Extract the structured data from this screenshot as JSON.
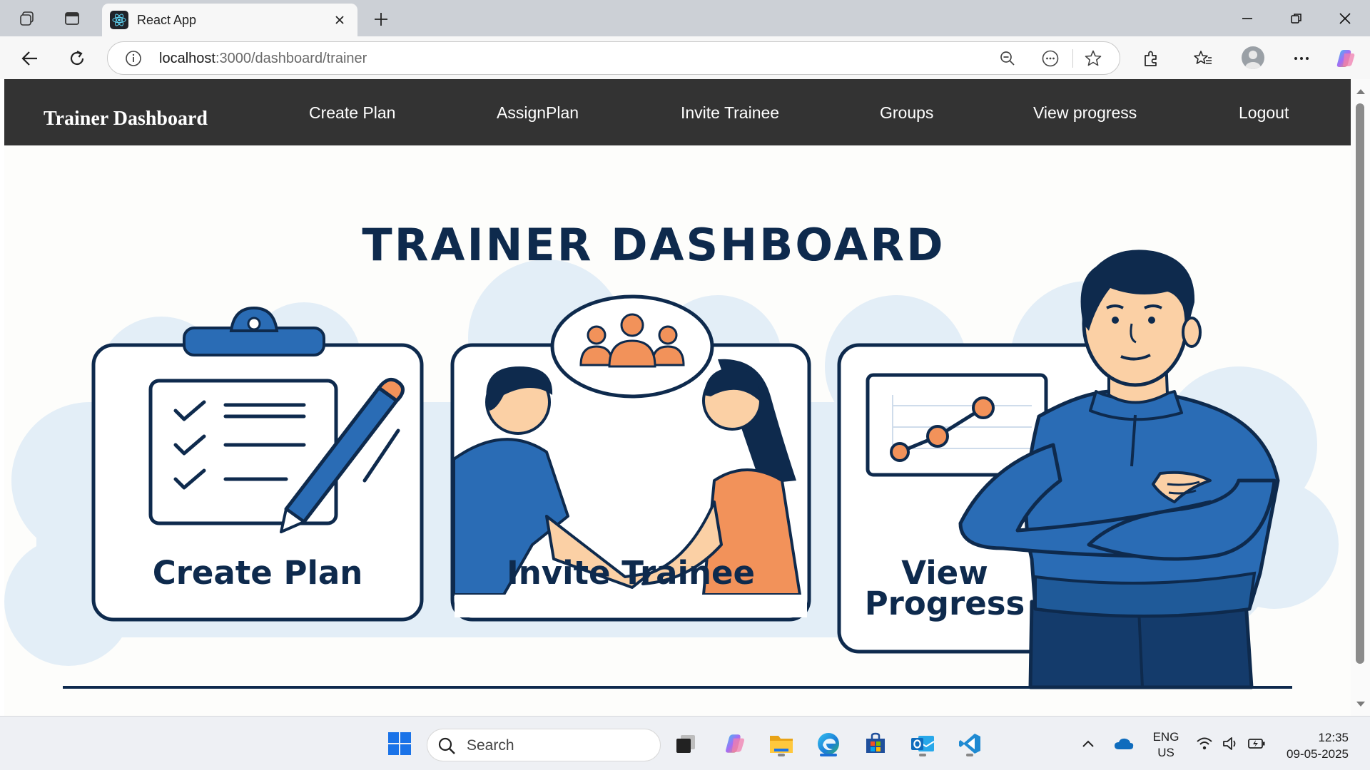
{
  "browser": {
    "tab_title": "React App",
    "url_host": "localhost",
    "url_path": ":3000/dashboard/trainer"
  },
  "app": {
    "brand": "Trainer Dashboard",
    "nav": [
      "Create Plan",
      "AssignPlan",
      "Invite Trainee",
      "Groups",
      "View progress",
      "Logout"
    ]
  },
  "hero": {
    "title": "TRAINER DASHBOARD",
    "cards": [
      {
        "label": "Create Plan",
        "icon": "clipboard-checklist-icon"
      },
      {
        "label": "Invite Trainee",
        "icon": "handshake-icon"
      },
      {
        "label_line1": "View",
        "label_line2": "Progress",
        "icon": "progress-chart-icon"
      }
    ]
  },
  "taskbar": {
    "search_placeholder": "Search",
    "lang_line1": "ENG",
    "lang_line2": "US",
    "time": "12:35",
    "date": "09-05-2025"
  },
  "colors": {
    "nav_bg": "#333333",
    "navy": "#0e2a4d",
    "blue": "#2a6cb5",
    "orange": "#f2925a",
    "cloud": "#e3eef7"
  }
}
